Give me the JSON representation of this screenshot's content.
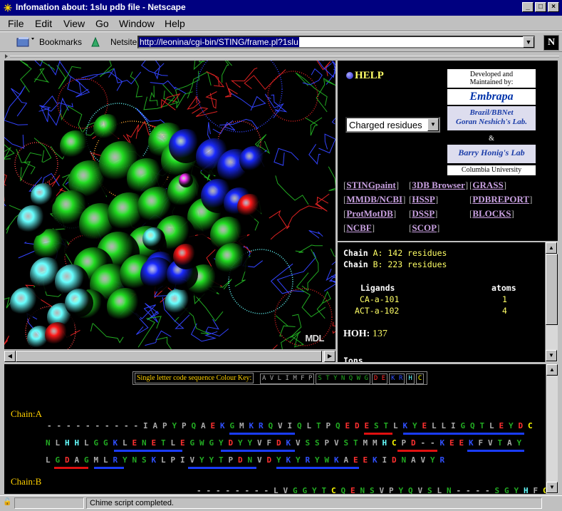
{
  "window": {
    "title": "Infomation about: 1slu pdb file - Netscape",
    "minimize": "_",
    "maximize": "□",
    "close": "×"
  },
  "menu": [
    "File",
    "Edit",
    "View",
    "Go",
    "Window",
    "Help"
  ],
  "location": {
    "bookmarks_label": "Bookmarks",
    "netsite_label": "Netsite:",
    "url": "http://leonina/cgi-bin/STING/frame.pl?1slu"
  },
  "viewer": {
    "watermark": "MDL"
  },
  "help_panel": {
    "help_label": "HELP",
    "selected_option": "Charged residues",
    "credits": {
      "line1": "Developed and",
      "line2": "Maintained by:",
      "embrapa": "Embrapa",
      "brazil1": "Brazil/BBNet",
      "brazil2": "Goran Neshich's Lab.",
      "amp": "&",
      "honig": "Barry Honig's Lab",
      "columbia": "Columbia University"
    },
    "links": [
      [
        "STINGpaint",
        "3DB Browser",
        "GRASS"
      ],
      [
        "MMDB/NCBI",
        "HSSP",
        "PDBREPORT"
      ],
      [
        "ProtMotDB",
        "DSSP",
        "BLOCKS"
      ],
      [
        "NCBF",
        "SCOP",
        ""
      ]
    ]
  },
  "info_panel": {
    "chain_a": {
      "label": "Chain",
      "id": "A:",
      "count": "142 residues"
    },
    "chain_b": {
      "label": "Chain",
      "id": "B:",
      "count": "223 residues"
    },
    "ligands_header": "Ligands",
    "atoms_header": "atoms",
    "ligands": [
      {
        "name": "CA-a-101",
        "atoms": "1"
      },
      {
        "name": "ACT-a-102",
        "atoms": "4"
      }
    ],
    "hoh_label": "HOH:",
    "hoh_value": "137",
    "ions_label": "Ions"
  },
  "sequence_panel": {
    "key_label": "Single letter code sequence Colour Key:",
    "key_groups": [
      {
        "text": "AVLIMFP",
        "color": "#aaaaaa"
      },
      {
        "text": "STYNQWG",
        "color": "#22aa22"
      },
      {
        "text": "DE",
        "color": "#ff3030"
      },
      {
        "text": "KR",
        "color": "#3050ff"
      },
      {
        "text": "H",
        "color": "#66ffff"
      },
      {
        "text": "C",
        "color": "#ffff00"
      }
    ],
    "chain_a_label": "Chain:A",
    "chain_b_label": "Chain:B",
    "rows": [
      "----------IAPYPQAEKGMKRQVIQLTPQEDESTLKYELLIGQTLEYDC",
      "NLHHLGGKLENETLEGWGYDYYVFDKVSSPVSTMMHCPD--KEEKFVTAY",
      "LGDAGMLRYNSKLPIVYYTPDNVDYKYRYWKAEEKIDNAVYR",
      "--------LVGGYTCQENSVPYQVSLN----SGYHFCGGSLINDQ"
    ]
  },
  "status": {
    "message": "Chime script completed."
  }
}
